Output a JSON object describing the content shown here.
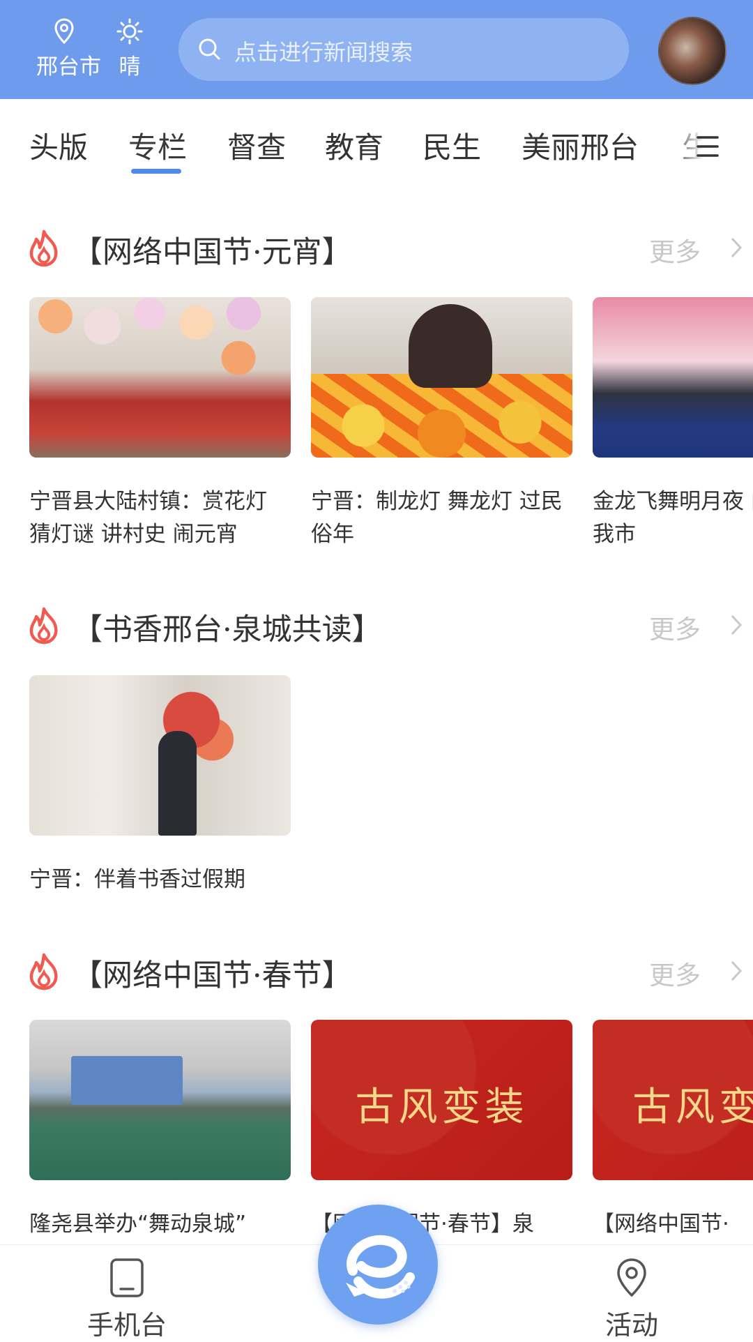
{
  "header": {
    "location": "邢台市",
    "weather": "晴",
    "search_placeholder": "点击进行新闻搜索"
  },
  "tabs": [
    "头版",
    "专栏",
    "督查",
    "教育",
    "民生",
    "美丽邢台",
    "生"
  ],
  "active_tab": "专栏",
  "sections": [
    {
      "title": "【网络中国节·元宵】",
      "more": "更多",
      "cards": [
        {
          "text": "宁晋县大陆村镇：赏花灯 猜灯谜 讲村史 闹元宵"
        },
        {
          "text": "宁晋：制龙灯 舞龙灯 过民俗年"
        },
        {
          "text": "金龙飞舞明月夜 曲暖邢襄 我市"
        }
      ]
    },
    {
      "title": "【书香邢台·泉城共读】",
      "more": "更多",
      "cards": [
        {
          "text": "宁晋：伴着书香过假期"
        }
      ]
    },
    {
      "title": "【网络中国节·春节】",
      "more": "更多",
      "cards": [
        {
          "text": "隆尧县举办“舞动泉城”",
          "image_text": ""
        },
        {
          "text": "【网络中国节·春节】泉",
          "image_text": "古风变装"
        },
        {
          "text": "【网络中国节·",
          "image_text": "古风变"
        }
      ]
    }
  ],
  "bottom_nav": {
    "left": "手机台",
    "right": "活动"
  },
  "colors": {
    "header_bg": "#6e9bec",
    "accent": "#4f8aea",
    "fire_icon": "#f05a50"
  }
}
